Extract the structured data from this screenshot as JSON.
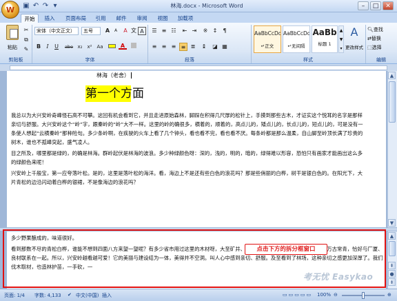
{
  "window": {
    "title": "林海.docx - Microsoft Word",
    "office_button_glyph": "W",
    "qat": {
      "save_icon": "save-icon",
      "undo_icon": "undo-icon",
      "redo_icon": "redo-icon",
      "dropdown_icon": "qat-dropdown-icon"
    },
    "controls": {
      "minimize": "–",
      "maximize": "□",
      "close": "✕"
    }
  },
  "ribbon": {
    "tabs": [
      "开始",
      "插入",
      "页面布局",
      "引用",
      "邮件",
      "审阅",
      "视图",
      "加载项"
    ],
    "active_tab": 0,
    "clipboard": {
      "label": "剪贴板",
      "paste_label": "粘贴"
    },
    "font": {
      "label": "字体",
      "font_name": "宋体（中文正文）",
      "font_size": "五号",
      "bold": "B",
      "italic": "I",
      "underline": "U",
      "strike": "abe",
      "subscript": "x₂",
      "superscript": "x²",
      "change_case": "Aa",
      "grow": "A",
      "shrink": "A",
      "clear": "A",
      "font_color": "A",
      "phonetic": "文",
      "border_char": "A"
    },
    "paragraph": {
      "label": "段落"
    },
    "styles": {
      "label": "样式",
      "items": [
        {
          "sample": "AaBbCcDd",
          "name": "↵正文"
        },
        {
          "sample": "AaBbCcDd",
          "name": "↵无间隔"
        },
        {
          "sample": "AaBb",
          "name": "标题 1"
        }
      ],
      "change_styles_label": "更改样式"
    },
    "editing": {
      "label": "编辑",
      "find": "查找",
      "replace": "替换",
      "select": "选择"
    }
  },
  "document": {
    "author_line": "林海（老舍）",
    "heading": "第一个方面",
    "upper_paragraphs": [
      "我总以为大兴安岭奇峰怪石高不可攀。这回有机会看到它，并且走进原始森林，脚踩在积得几尺厚的松针上，手摸到那些古木，才证实这个悦耳的名字是那样亲切与舒服。大兴安岭这个“岭”字，跟秦岭的“岭”大不一样。这里的岭的确很多，横着的，顺着的，高点儿的，矮点儿的，长点儿的，短点儿的，可是没有一条使人想起“云横秦岭”那种险句。多少条岭啊，在疾驶的火车上看了几个钟头，看也看不完，看也看不厌。每条岭都是那么温柔，自山脚至岭顶长满了珍贵的树木，谁也不孤峰突起，盛气凌人。",
      "目之所及，哪里都是绿的，的确是林海。群岭起伏是林海的波浪。多少种绿颜色呀：深的，浅的，明的，暗的，绿得难以形容，恐怕只有画家才能画出这么多的绿颜色来呢！",
      "兴安岭上千般宝，第一应夸落叶松。是的，这里是落叶松的海洋。看，海边上不是还有些白色的浪花吗？那是些俏丽的白桦，树干是银白色的。在阳光下，大片青松的边沿闪动着白桦的银裙，不是像海边的浪花吗？"
    ],
    "lower_paragraphs": [
      "多少野果酿成的，味道很好。",
      "看到那数不尽的青松白桦，谁能不想到四面八方来望一望呢？有多少省市用过这里的木材呀，大至矿井、铁路，小至桌椅、桌椅，千山一碧，万古常青，恰好与厂厦、良材联系在一起。所以，兴安岭越看越可爱！它的美丽与建设结为一体，美得并不空洞。叫人心中感到亲切、舒服。及至看到了林场，这种亲切之感更加深厚了。我们伐木取材，也造林护苗，一手砍，一"
    ]
  },
  "annotation": {
    "callout_text": "点击下方的拆分框窗口"
  },
  "watermark": "考无忧 Easykao",
  "statusbar": {
    "page": "页面: 1/4",
    "words": "字数: 4,133",
    "language": "中文(中国)",
    "mode": "插入",
    "zoom": "100%"
  }
}
